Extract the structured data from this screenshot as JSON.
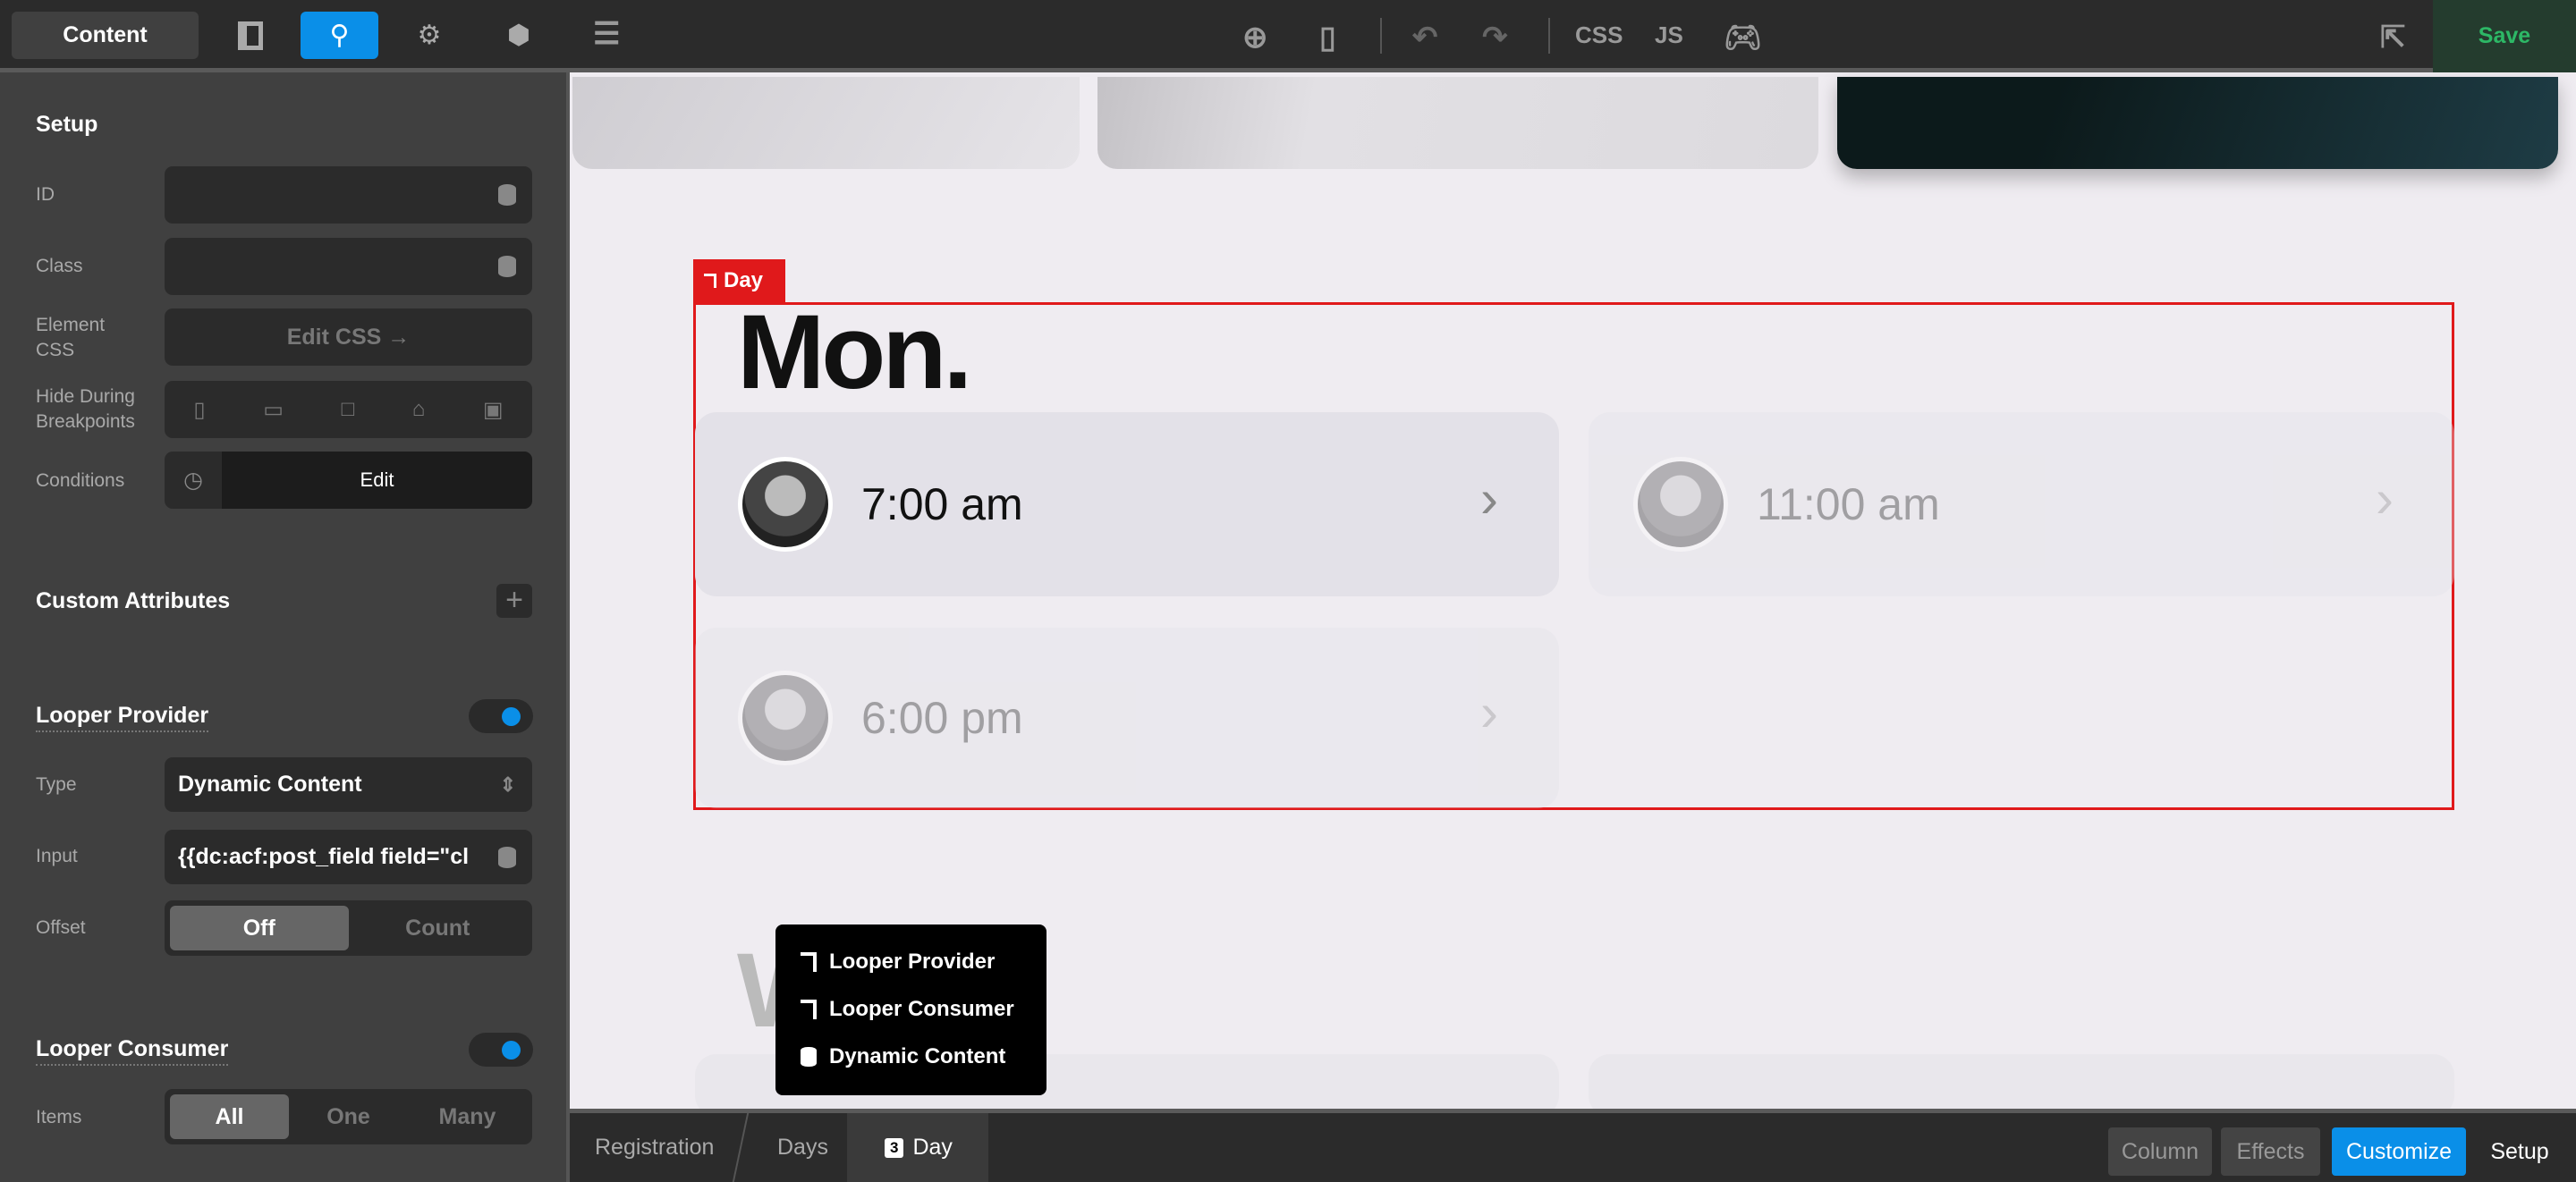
{
  "sidebar": {
    "tabs": {
      "content": "Content"
    },
    "setup": {
      "title": "Setup",
      "id_label": "ID",
      "class_label": "Class",
      "element_css_label": "Element CSS",
      "edit_css": "Edit CSS →",
      "hide_label": "Hide During Breakpoints",
      "conditions_label": "Conditions",
      "conditions_edit": "Edit"
    },
    "custom_attributes": "Custom Attributes",
    "looper_provider": {
      "title": "Looper Provider",
      "enabled": true,
      "type_label": "Type",
      "type_value": "Dynamic Content",
      "input_label": "Input",
      "input_value": "{{dc:acf:post_field field=\"cl",
      "offset_label": "Offset",
      "offset_options": [
        "Off",
        "Count"
      ],
      "offset_selected": "Off"
    },
    "looper_consumer": {
      "title": "Looper Consumer",
      "enabled": true,
      "items_label": "Items",
      "items_options": [
        "All",
        "One",
        "Many"
      ],
      "items_selected": "All"
    }
  },
  "toolbar": {
    "css": "CSS",
    "js": "JS",
    "save": "Save"
  },
  "canvas": {
    "element_label": "Day",
    "day_heading": "Mon.",
    "next_heading": "W",
    "times": [
      "7:00 am",
      "11:00 am",
      "6:00 pm"
    ]
  },
  "popup": {
    "items": [
      "Looper Provider",
      "Looper Consumer",
      "Dynamic Content"
    ]
  },
  "breadcrumbs": [
    "Registration",
    "Days",
    "Day"
  ],
  "breadcrumb_badge": "3",
  "bottom_buttons": [
    "Column",
    "Effects",
    "Customize",
    "Setup"
  ],
  "colors": {
    "accent": "#0a8fe8",
    "selection": "#e0191b",
    "save": "#2db866"
  }
}
